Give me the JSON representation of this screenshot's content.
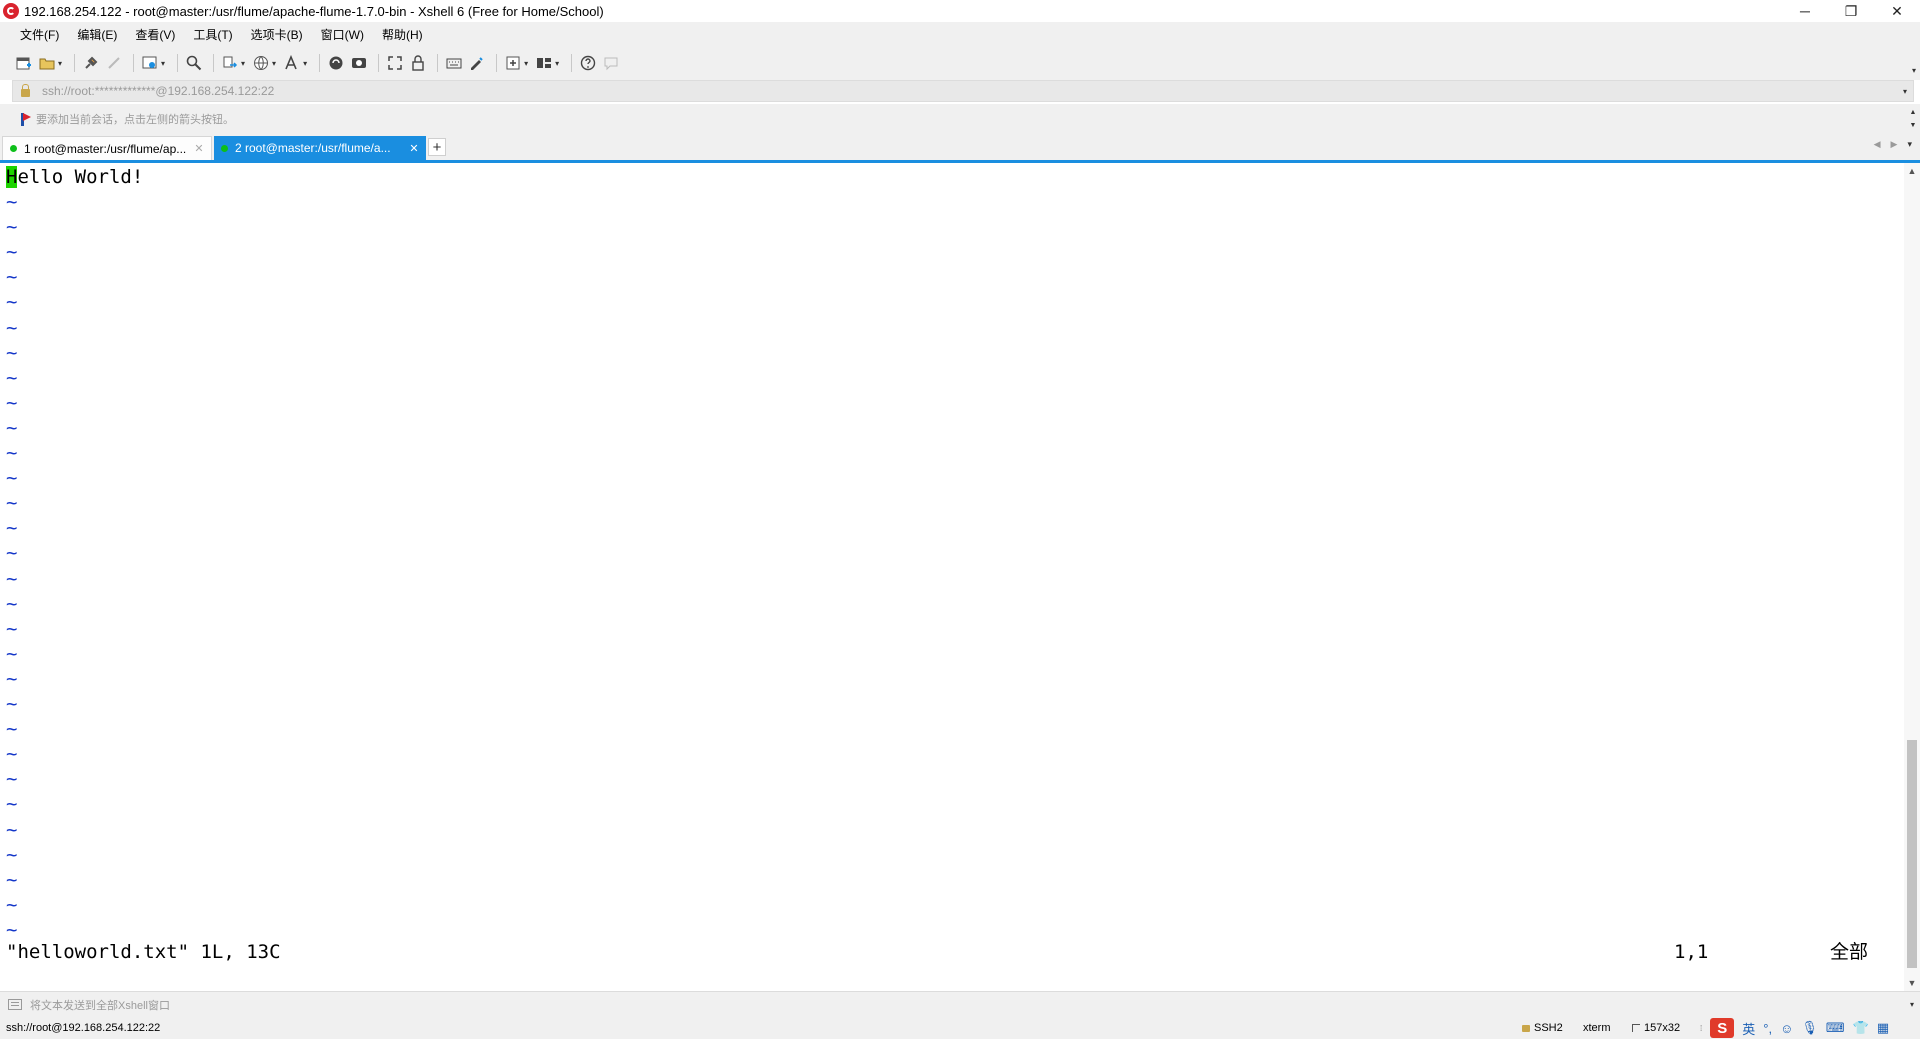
{
  "window": {
    "title": "192.168.254.122 - root@master:/usr/flume/apache-flume-1.7.0-bin - Xshell 6 (Free for Home/School)",
    "minimize": "─",
    "restore": "❐",
    "close": "✕"
  },
  "menu": {
    "items": [
      "文件(F)",
      "编辑(E)",
      "查看(V)",
      "工具(T)",
      "选项卡(B)",
      "窗口(W)",
      "帮助(H)"
    ]
  },
  "toolbar": {
    "icons": [
      "new-session-icon",
      "open-folder-icon",
      "reconnect-icon",
      "disconnect-icon",
      "properties-icon",
      "find-icon",
      "transfer-icon",
      "globe-icon",
      "font-icon",
      "xftp-icon",
      "xmanager-icon",
      "fullscreen-icon",
      "lock-icon",
      "keyboard-icon",
      "script-icon",
      "add-tab-icon",
      "layout-icon",
      "help-icon",
      "chat-icon"
    ]
  },
  "address": {
    "text": "ssh://root:*************@192.168.254.122:22"
  },
  "hint": {
    "text": "要添加当前会话，点击左侧的箭头按钮。"
  },
  "tabs": [
    {
      "label": "1 root@master:/usr/flume/ap...",
      "active": false
    },
    {
      "label": "2 root@master:/usr/flume/a...",
      "active": true
    }
  ],
  "tab_add": "+",
  "terminal": {
    "first_line_cursor_char": "H",
    "first_line_rest": "ello World!",
    "tilde": "~",
    "tilde_count": 30,
    "status_file": "\"helloworld.txt\" 1L, 13C",
    "status_pos": "1,1",
    "status_scope": "全部"
  },
  "compose": {
    "placeholder": "将文本发送到全部Xshell窗口"
  },
  "statusbar": {
    "connection": "ssh://root@192.168.254.122:22",
    "protocol": "SSH2",
    "terminal_type": "xterm",
    "size": "157x32",
    "ime_logo": "S",
    "ime_lang": "英"
  },
  "colors": {
    "active_tab": "#1a8ee0",
    "session_dot": "#0dbf1a",
    "cursor": "#1dd300",
    "tilde": "#1336c8"
  }
}
